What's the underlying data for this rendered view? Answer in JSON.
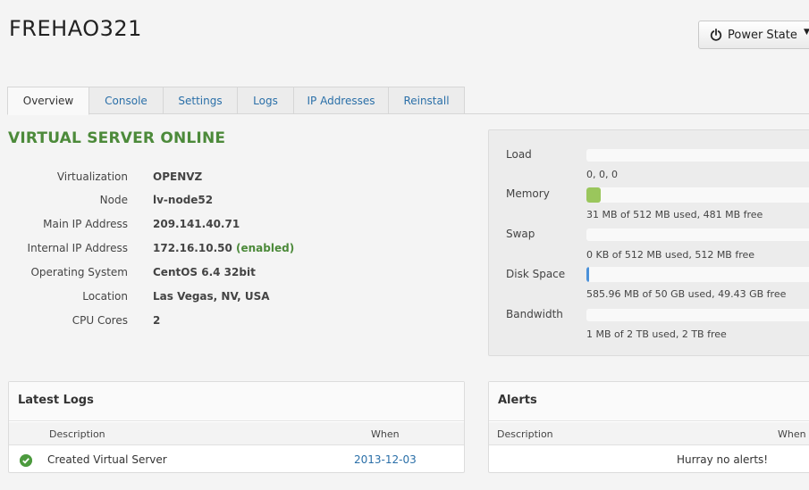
{
  "server": {
    "hostname": "FREHAO321",
    "status": "VIRTUAL SERVER ONLINE"
  },
  "power_button": {
    "label": "Power State",
    "caret": "▼"
  },
  "tabs": [
    {
      "label": "Overview",
      "active": true
    },
    {
      "label": "Console"
    },
    {
      "label": "Settings"
    },
    {
      "label": "Logs"
    },
    {
      "label": "IP Addresses"
    },
    {
      "label": "Reinstall"
    }
  ],
  "info": [
    {
      "label": "Virtualization",
      "value": "OPENVZ"
    },
    {
      "label": "Node",
      "value": "lv-node52"
    },
    {
      "label": "Main IP Address",
      "value": "209.141.40.71"
    },
    {
      "label": "Internal IP Address",
      "value": "172.16.10.50",
      "suffix": "(enabled)"
    },
    {
      "label": "Operating System",
      "value": "CentOS 6.4 32bit"
    },
    {
      "label": "Location",
      "value": "Las Vegas, NV, USA"
    },
    {
      "label": "CPU Cores",
      "value": "2"
    }
  ],
  "resources": [
    {
      "label": "Load",
      "text": "0, 0, 0",
      "fraction": 0,
      "color": "#9ac65c"
    },
    {
      "label": "Memory",
      "text": "31 MB of 512 MB used, 481 MB free",
      "fraction": 0.06,
      "color": "#9ac65c"
    },
    {
      "label": "Swap",
      "text": "0 KB of 512 MB used, 512 MB free",
      "fraction": 0,
      "color": "#9ac65c"
    },
    {
      "label": "Disk Space",
      "text": "585.96 MB of 50 GB used, 49.43 GB free",
      "fraction": 0.012,
      "color": "#4a90d9"
    },
    {
      "label": "Bandwidth",
      "text": "1 MB of 2 TB used, 2 TB free",
      "fraction": 0,
      "color": "#9ac65c"
    }
  ],
  "logs_panel": {
    "title": "Latest Logs",
    "columns": {
      "description": "Description",
      "when": "When"
    },
    "rows": [
      {
        "description": "Created Virtual Server",
        "when": "2013-12-03"
      }
    ]
  },
  "alerts_panel": {
    "title": "Alerts",
    "columns": {
      "description": "Description",
      "when": "When"
    },
    "empty_message": "Hurray no alerts!"
  },
  "colors": {
    "accent_green": "#4c8a3a",
    "link_blue": "#2a6fa8"
  }
}
